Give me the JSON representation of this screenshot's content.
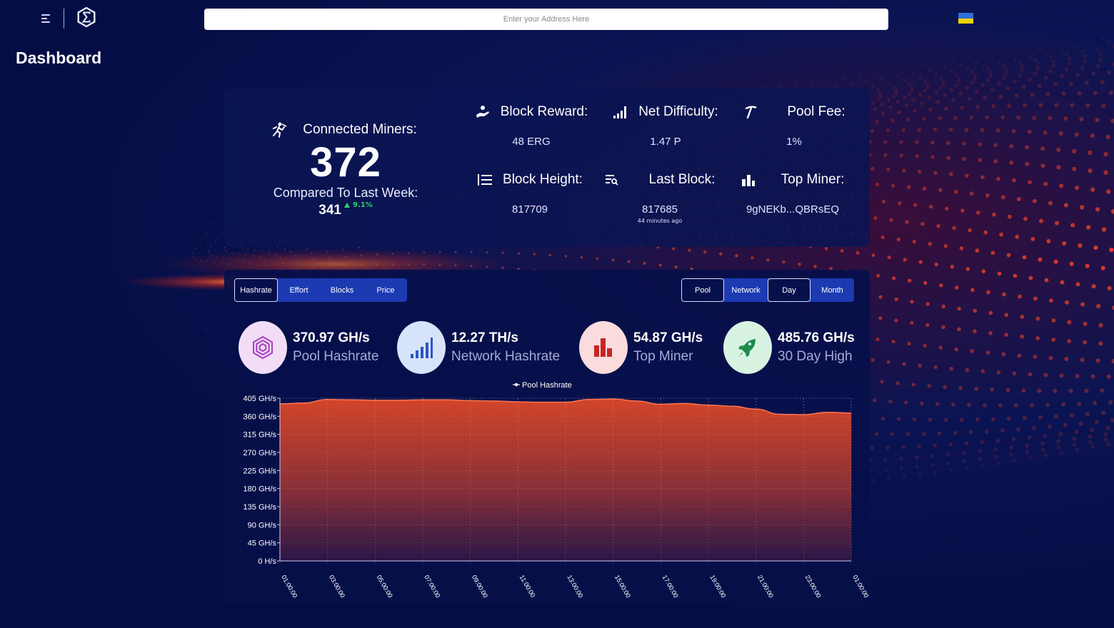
{
  "header": {
    "address_placeholder": "Enter your Address Here",
    "page_title": "Dashboard"
  },
  "miners": {
    "label": "Connected Miners:",
    "count": "372",
    "compare_label": "Compared To Last Week:",
    "compare_value": "341",
    "compare_change": "9.1%"
  },
  "stats": {
    "block_reward": {
      "label": "Block Reward:",
      "value": "48 ERG"
    },
    "net_difficulty": {
      "label": "Net Difficulty:",
      "value": "1.47 P"
    },
    "pool_fee": {
      "label": "Pool Fee:",
      "value": "1%"
    },
    "block_height": {
      "label": "Block Height:",
      "value": "817709"
    },
    "last_block": {
      "label": "Last Block:",
      "value": "817685",
      "sub": "44 minutes ago"
    },
    "top_miner": {
      "label": "Top Miner:",
      "value": "9gNEKb...QBRsEQ"
    }
  },
  "tabs": {
    "left": [
      "Hashrate",
      "Effort",
      "Blocks",
      "Price"
    ],
    "right_source": [
      "Pool",
      "Network"
    ],
    "right_period": [
      "Day",
      "Month"
    ]
  },
  "metrics": [
    {
      "value": "370.97 GH/s",
      "label": "Pool Hashrate",
      "icon": "hexagon-icon",
      "bg": "#f3dcf6",
      "fg": "#a33fc0"
    },
    {
      "value": "12.27 TH/s",
      "label": "Network Hashrate",
      "icon": "signal-bars-icon",
      "bg": "#d6e3fb",
      "fg": "#2a56c6"
    },
    {
      "value": "54.87 GH/s",
      "label": "Top Miner",
      "icon": "bar-chart-icon",
      "bg": "#fbdcdc",
      "fg": "#c62828"
    },
    {
      "value": "485.76 GH/s",
      "label": "30 Day High",
      "icon": "rocket-icon",
      "bg": "#d9f3e2",
      "fg": "#1e8a4a"
    }
  ],
  "colors": {
    "accent": "#1c3bb3",
    "positive": "#2ed06e",
    "chart_top": "#d2452a",
    "chart_bottom": "#2a1648"
  },
  "chart_data": {
    "type": "area",
    "title": "",
    "legend": [
      "Pool Hashrate"
    ],
    "legend_position": "top-center",
    "xlabel": "",
    "ylabel": "",
    "y_ticks": [
      "0 H/s",
      "45 GH/s",
      "90 GH/s",
      "135 GH/s",
      "180 GH/s",
      "225 GH/s",
      "270 GH/s",
      "315 GH/s",
      "360 GH/s",
      "405 GH/s"
    ],
    "ylim": [
      0,
      405
    ],
    "x_ticks": [
      "01:00:00",
      "03:00:00",
      "05:00:00",
      "07:00:00",
      "09:00:00",
      "11:00:00",
      "13:00:00",
      "15:00:00",
      "17:00:00",
      "19:00:00",
      "21:00:00",
      "23:00:00",
      "01:00:00"
    ],
    "grid": true,
    "series": [
      {
        "name": "Pool Hashrate",
        "x": [
          "01:00",
          "02:00",
          "03:00",
          "04:00",
          "05:00",
          "06:00",
          "07:00",
          "08:00",
          "09:00",
          "10:00",
          "11:00",
          "12:00",
          "13:00",
          "14:00",
          "15:00",
          "16:00",
          "17:00",
          "18:00",
          "19:00",
          "20:00",
          "21:00",
          "22:00",
          "23:00",
          "00:00",
          "01:00"
        ],
        "values": [
          391,
          393,
          402,
          401,
          400,
          400,
          401,
          401,
          399,
          398,
          396,
          395,
          395,
          402,
          403,
          398,
          390,
          392,
          388,
          385,
          378,
          365,
          364,
          370,
          368
        ]
      }
    ]
  }
}
